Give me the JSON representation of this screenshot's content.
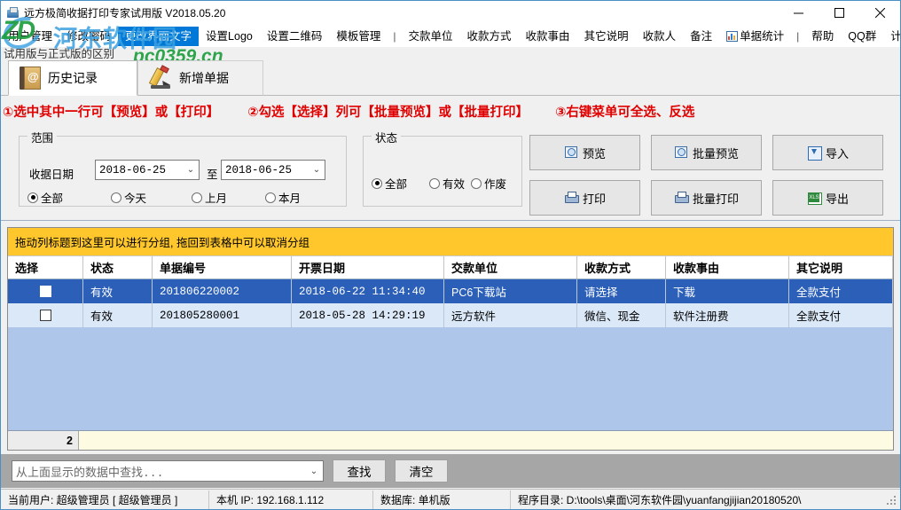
{
  "window": {
    "title": "远方极简收据打印专家试用版 V2018.05.20",
    "icon": "app-icon",
    "minimize": "—",
    "maximize": "□",
    "close": "✕"
  },
  "watermark": {
    "logo": "ZD",
    "cn": "河东软件园",
    "url": "pc0359.cn"
  },
  "menubar": {
    "items": [
      {
        "label": "用户管理",
        "active": false
      },
      {
        "label": "修改密码",
        "active": false
      },
      {
        "label": "更改界面文字",
        "active": true
      },
      {
        "label": "设置Logo",
        "active": false
      },
      {
        "label": "设置二维码",
        "active": false
      },
      {
        "label": "模板管理",
        "active": false
      },
      {
        "label": "|",
        "separator": true
      },
      {
        "label": "交款单位",
        "active": false
      },
      {
        "label": "收款方式",
        "active": false
      },
      {
        "label": "收款事由",
        "active": false
      },
      {
        "label": "其它说明",
        "active": false
      },
      {
        "label": "收款人",
        "active": false
      },
      {
        "label": "备注",
        "active": false
      },
      {
        "label": "单据统计",
        "active": false,
        "icon": "chart-icon"
      },
      {
        "label": "|",
        "separator": true
      },
      {
        "label": "帮助",
        "active": false
      },
      {
        "label": "QQ群",
        "active": false
      },
      {
        "label": "计算器",
        "active": false
      }
    ],
    "subtip": "试用版与正式版的区别"
  },
  "tabs": [
    {
      "label": "历史记录",
      "icon": "book-icon",
      "selected": true
    },
    {
      "label": "新增单据",
      "icon": "pencil-icon",
      "selected": false
    }
  ],
  "hints": {
    "a": "①选中其中一行可【预览】或【打印】",
    "b": "②勾选【选择】列可【批量预览】或【批量打印】",
    "c": "③右键菜单可全选、反选",
    "color": "#e00000"
  },
  "filters": {
    "range": {
      "title": "范围",
      "date_label": "收据日期",
      "date_from": "2018-06-25",
      "between_label": "至",
      "date_to": "2018-06-25",
      "options": [
        {
          "label": "全部",
          "checked": true
        },
        {
          "label": "今天",
          "checked": false
        },
        {
          "label": "上月",
          "checked": false
        },
        {
          "label": "本月",
          "checked": false
        }
      ]
    },
    "status": {
      "title": "状态",
      "options": [
        {
          "label": "全部",
          "checked": true
        },
        {
          "label": "有效",
          "checked": false
        },
        {
          "label": "作废",
          "checked": false
        }
      ]
    },
    "buttons": [
      {
        "label": "预览",
        "icon": "preview-icon"
      },
      {
        "label": "批量预览",
        "icon": "preview-icon"
      },
      {
        "label": "导入",
        "icon": "import-icon"
      },
      {
        "label": "打印",
        "icon": "print-icon"
      },
      {
        "label": "批量打印",
        "icon": "print-icon"
      },
      {
        "label": "导出",
        "icon": "export-icon"
      }
    ]
  },
  "grid": {
    "group_hint": "拖动列标题到这里可以进行分组, 拖回到表格中可以取消分组",
    "columns": [
      "选择",
      "状态",
      "单据编号",
      "开票日期",
      "交款单位",
      "收款方式",
      "收款事由",
      "其它说明"
    ],
    "rows": [
      {
        "selected": true,
        "checked": false,
        "status": "有效",
        "number": "201806220002",
        "date": "2018-06-22 11:34:40",
        "payer": "PC6下载站",
        "method": "请选择",
        "reason": "下载",
        "note": "全款支付"
      },
      {
        "selected": false,
        "checked": false,
        "status": "有效",
        "number": "201805280001",
        "date": "2018-05-28 14:29:19",
        "payer": "远方软件",
        "method": "微信、现金",
        "reason": "软件注册费",
        "note": "全款支付"
      }
    ],
    "footer_count": "2"
  },
  "search": {
    "placeholder": "从上面显示的数据中查找...",
    "find_label": "查找",
    "clear_label": "清空"
  },
  "statusbar": {
    "user": "当前用户: 超级管理员 [ 超级管理员 ]",
    "ip": "本机 IP: 192.168.1.112",
    "db": "数据库: 单机版",
    "dir": "程序目录: D:\\tools\\桌面\\河东软件园\\yuanfangjijian20180520\\"
  }
}
